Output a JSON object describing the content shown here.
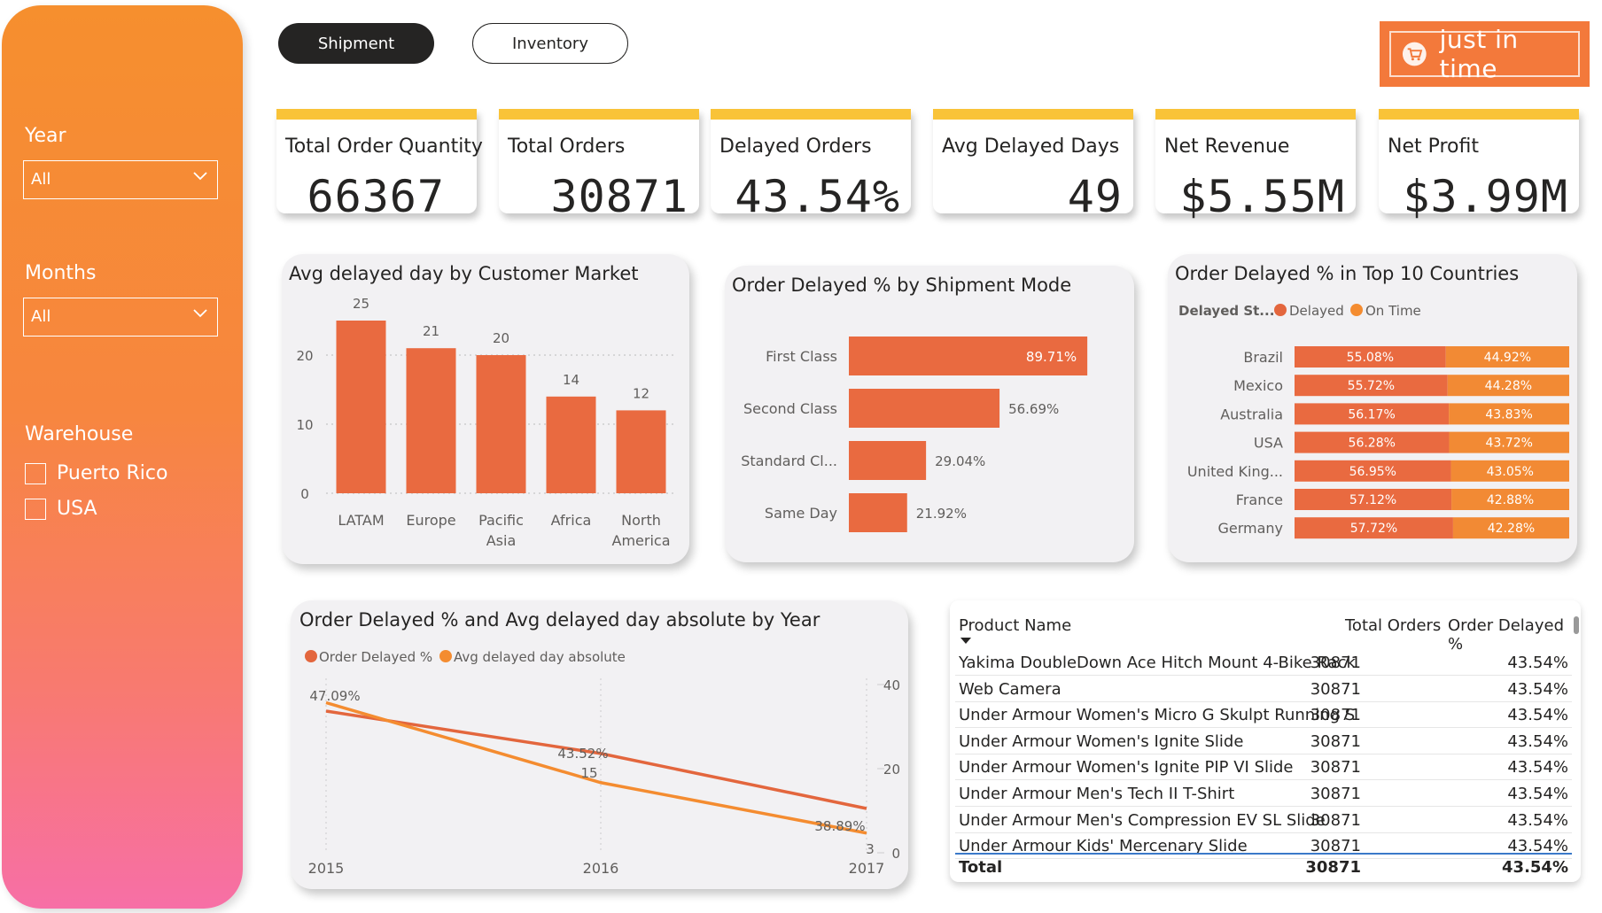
{
  "filters": {
    "year_label": "Year",
    "year_value": "All",
    "months_label": "Months",
    "months_value": "All",
    "warehouse_label": "Warehouse",
    "warehouse_options": [
      "Puerto Rico",
      "USA"
    ]
  },
  "tabs": {
    "shipment": "Shipment",
    "inventory": "Inventory"
  },
  "logo": {
    "text": "just in time",
    "icon": "cart-icon"
  },
  "kpis": [
    {
      "label": "Total Order Quantity",
      "value": "66367"
    },
    {
      "label": "Total Orders",
      "value": "30871"
    },
    {
      "label": "Delayed Orders",
      "value": "43.54%"
    },
    {
      "label": "Avg Delayed Days",
      "value": "49"
    },
    {
      "label": "Net Revenue",
      "value": "$5.55M"
    },
    {
      "label": "Net Profit",
      "value": "$3.99M"
    }
  ],
  "colors": {
    "bar": "#e96a40",
    "bar_light": "#f28a34",
    "accent_yellow": "#f9c338",
    "line1": "#e3663d",
    "line2": "#f48c30"
  },
  "chart_data": [
    {
      "type": "bar",
      "title": "Avg delayed day by Customer Market",
      "categories": [
        "LATAM",
        "Europe",
        "Pacific Asia",
        "Africa",
        "North America"
      ],
      "values": [
        25,
        21,
        20,
        14,
        12
      ],
      "ylim": [
        0,
        25
      ],
      "yticks": [
        0,
        10,
        20
      ],
      "grid": true
    },
    {
      "type": "bar",
      "orientation": "horizontal",
      "title": "Order Delayed % by Shipment Mode",
      "categories": [
        "First Class",
        "Second Class",
        "Standard Cl...",
        "Same Day"
      ],
      "values": [
        89.71,
        56.69,
        29.04,
        21.92
      ],
      "labels": [
        "89.71%",
        "56.69%",
        "29.04%",
        "21.92%"
      ]
    },
    {
      "type": "bar",
      "orientation": "horizontal",
      "stacked": "100%",
      "title": "Order Delayed % in Top 10 Countries",
      "legend_title": "Delayed St...",
      "legend_position": "top-left",
      "categories": [
        "Brazil",
        "Mexico",
        "Australia",
        "USA",
        "United King...",
        "France",
        "Germany"
      ],
      "series": [
        {
          "name": "Delayed",
          "values": [
            55.08,
            55.72,
            56.17,
            56.28,
            56.95,
            57.12,
            57.72
          ]
        },
        {
          "name": "On Time",
          "values": [
            44.92,
            44.28,
            43.83,
            43.72,
            43.05,
            42.88,
            42.28
          ]
        }
      ]
    },
    {
      "type": "line",
      "title": "Order Delayed % and Avg delayed day absolute by Year",
      "x": [
        "2015",
        "2016",
        "2017"
      ],
      "legend_position": "top-left",
      "series": [
        {
          "name": "Order Delayed %",
          "values": [
            47.09,
            43.52,
            38.89
          ],
          "labels": [
            "47.09%",
            "43.52%",
            "38.89%"
          ]
        },
        {
          "name": "Avg delayed day absolute",
          "values": [
            34,
            15,
            3
          ],
          "labels": [
            "",
            "15",
            "3"
          ]
        }
      ],
      "y2ticks": [
        0,
        20,
        40
      ]
    }
  ],
  "table": {
    "headers": [
      "Product Name",
      "Total Orders",
      "Order Delayed %"
    ],
    "rows": [
      [
        "Yakima DoubleDown Ace Hitch Mount 4-Bike Rack",
        "30871",
        "43.54%"
      ],
      [
        "Web Camera",
        "30871",
        "43.54%"
      ],
      [
        "Under Armour Women's Micro G Skulpt Running S",
        "30871",
        "43.54%"
      ],
      [
        "Under Armour Women's Ignite Slide",
        "30871",
        "43.54%"
      ],
      [
        "Under Armour Women's Ignite PIP VI Slide",
        "30871",
        "43.54%"
      ],
      [
        "Under Armour Men's Tech II T-Shirt",
        "30871",
        "43.54%"
      ],
      [
        "Under Armour Men's Compression EV SL Slide",
        "30871",
        "43.54%"
      ],
      [
        "Under Armour Kids' Mercenary Slide",
        "30871",
        "43.54%"
      ]
    ],
    "total": [
      "Total",
      "30871",
      "43.54%"
    ]
  }
}
